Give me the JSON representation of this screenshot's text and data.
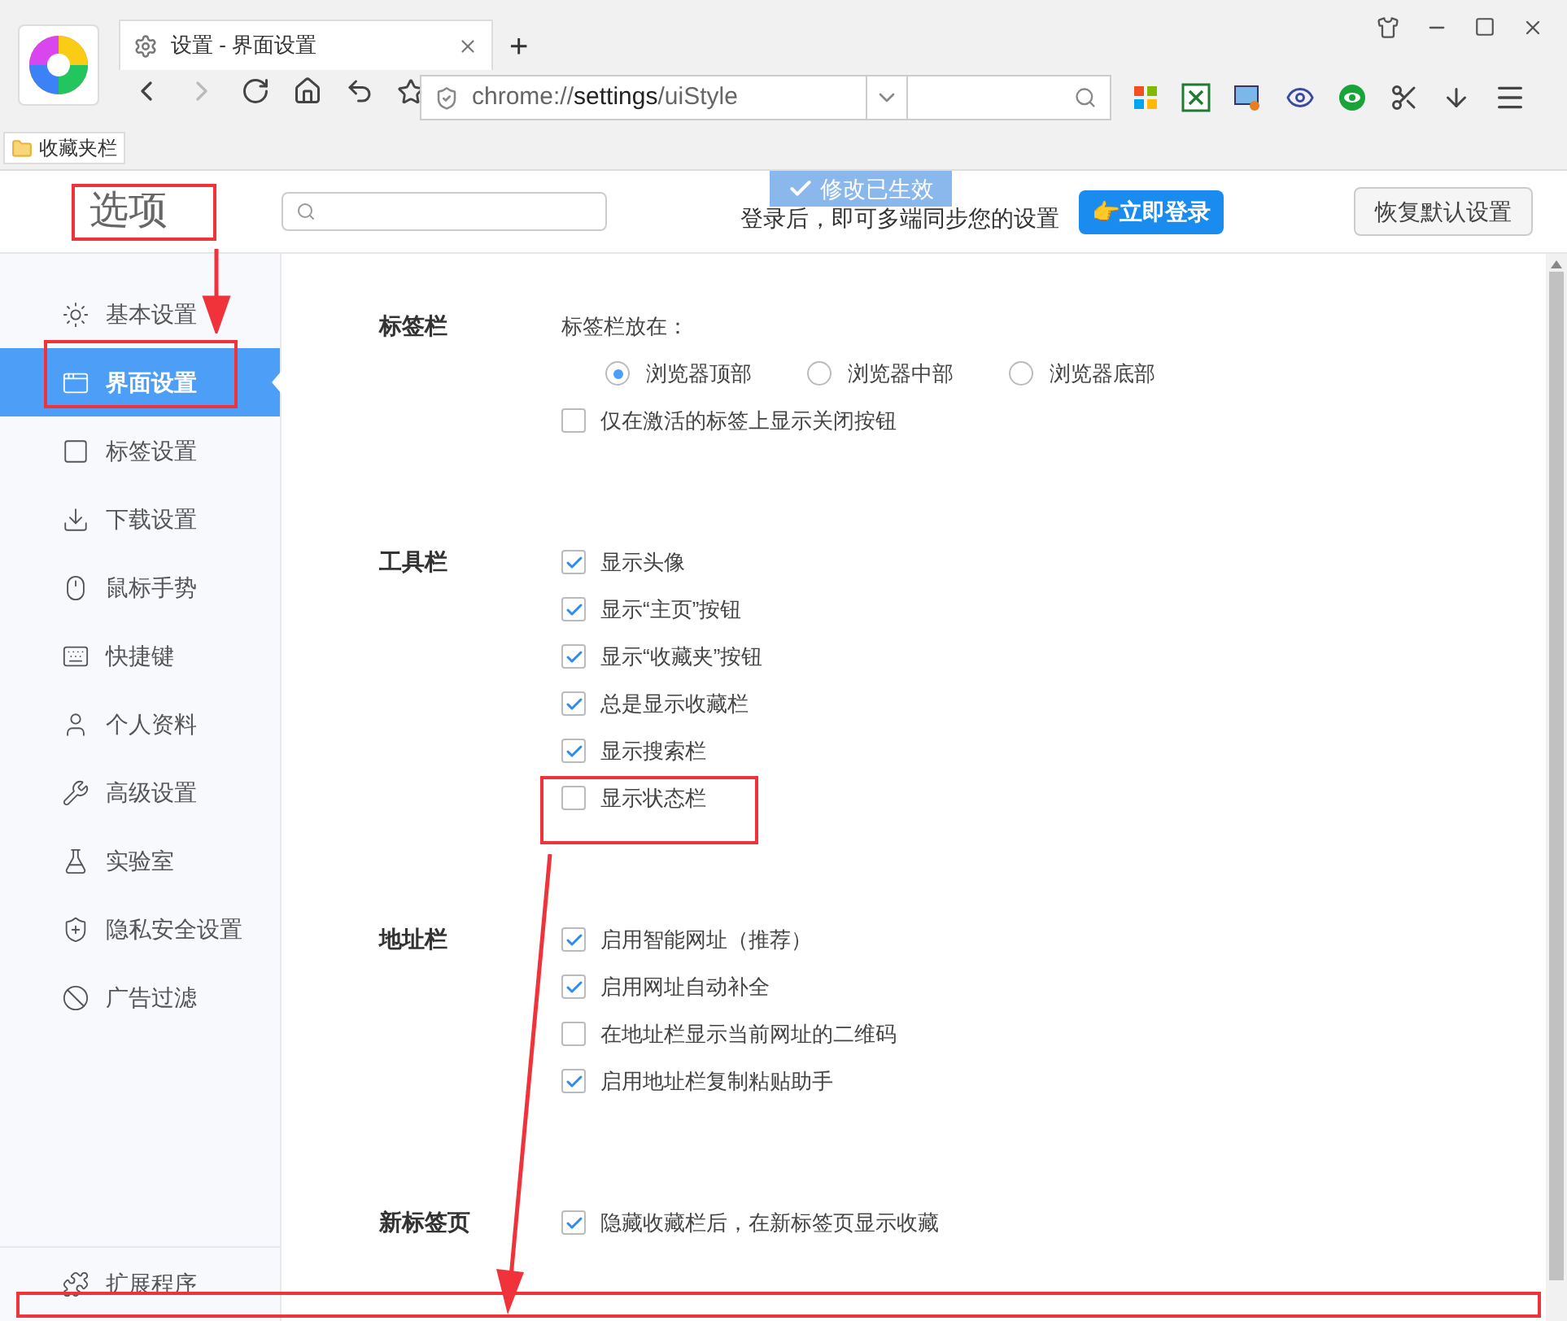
{
  "browser": {
    "tab_title": "设置 - 界面设置",
    "new_tab": "+",
    "address": {
      "prefix": "chrome://",
      "host": "settings",
      "path": "/uiStyle"
    },
    "bookmarks": [
      {
        "label": "收藏夹栏"
      }
    ]
  },
  "header": {
    "title": "选项",
    "login_hint": "登录后，即可多端同步您的设置",
    "login_button": "👉立即登录",
    "restore_button": "恢复默认设置",
    "toast": "修改已生效"
  },
  "sidebar": {
    "items": [
      {
        "label": "基本设置",
        "selected": false
      },
      {
        "label": "界面设置",
        "selected": true
      },
      {
        "label": "标签设置",
        "selected": false
      },
      {
        "label": "下载设置",
        "selected": false
      },
      {
        "label": "鼠标手势",
        "selected": false
      },
      {
        "label": "快捷键",
        "selected": false
      },
      {
        "label": "个人资料",
        "selected": false
      },
      {
        "label": "高级设置",
        "selected": false
      },
      {
        "label": "实验室",
        "selected": false
      },
      {
        "label": "隐私安全设置",
        "selected": false
      },
      {
        "label": "广告过滤",
        "selected": false
      }
    ],
    "footer": {
      "label": "扩展程序"
    }
  },
  "sections": [
    {
      "title": "标签栏",
      "options": [
        {
          "kind": "caption",
          "label": "标签栏放在："
        },
        {
          "kind": "radios",
          "choices": [
            {
              "label": "浏览器顶部",
              "selected": true
            },
            {
              "label": "浏览器中部",
              "selected": false
            },
            {
              "label": "浏览器底部",
              "selected": false
            }
          ]
        },
        {
          "kind": "checkbox",
          "label": "仅在激活的标签上显示关闭按钮",
          "checked": false
        }
      ]
    },
    {
      "title": "工具栏",
      "options": [
        {
          "kind": "checkbox",
          "label": "显示头像",
          "checked": true
        },
        {
          "kind": "checkbox",
          "label": "显示“主页”按钮",
          "checked": true
        },
        {
          "kind": "checkbox",
          "label": "显示“收藏夹”按钮",
          "checked": true
        },
        {
          "kind": "checkbox",
          "label": "总是显示收藏栏",
          "checked": true
        },
        {
          "kind": "checkbox",
          "label": "显示搜索栏",
          "checked": true
        },
        {
          "kind": "checkbox",
          "label": "显示状态栏",
          "checked": false
        }
      ]
    },
    {
      "title": "地址栏",
      "options": [
        {
          "kind": "checkbox",
          "label": "启用智能网址（推荐）",
          "checked": true
        },
        {
          "kind": "checkbox",
          "label": "启用网址自动补全",
          "checked": true
        },
        {
          "kind": "checkbox",
          "label": "在地址栏显示当前网址的二维码",
          "checked": false
        },
        {
          "kind": "checkbox",
          "label": "启用地址栏复制粘贴助手",
          "checked": true
        }
      ]
    },
    {
      "title": "新标签页",
      "options": [
        {
          "kind": "checkbox",
          "label": "隐藏收藏栏后，在新标签页显示收藏",
          "checked": true
        }
      ]
    }
  ]
}
